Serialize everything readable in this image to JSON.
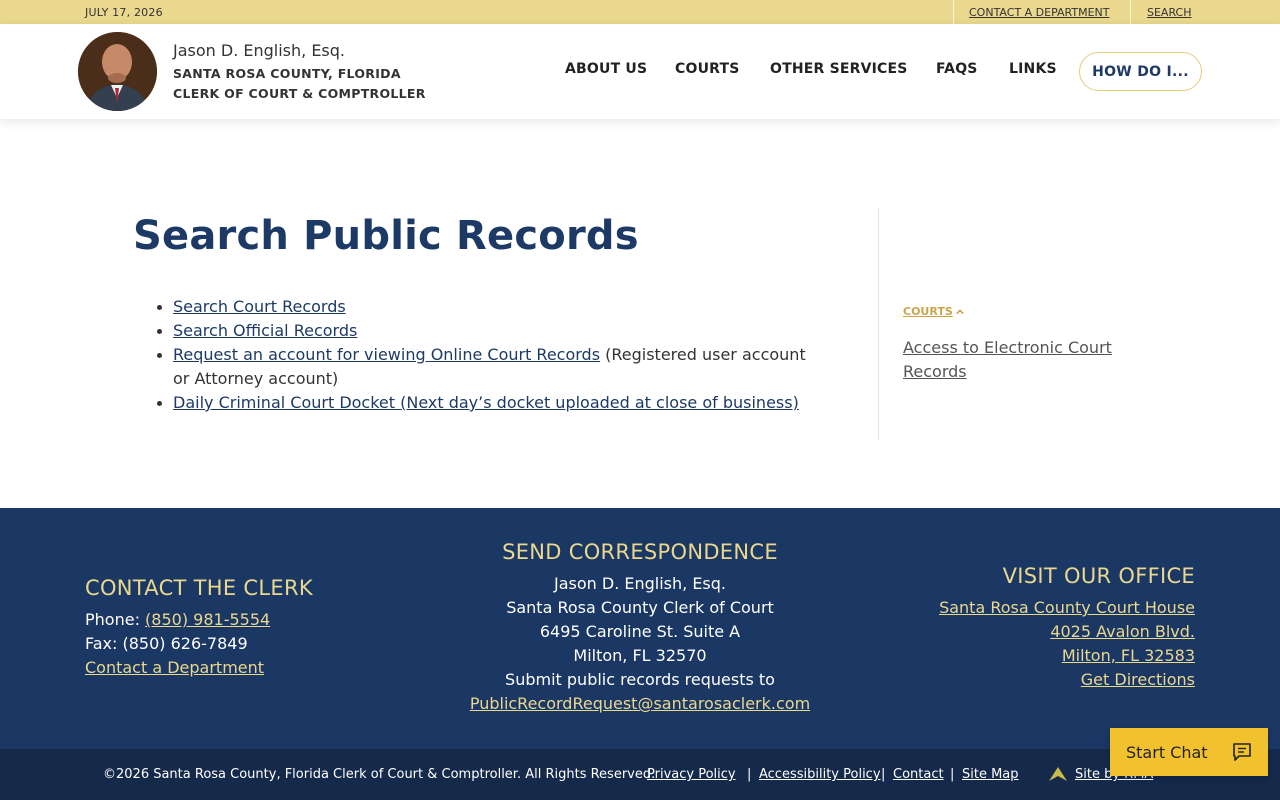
{
  "topbar": {
    "date": "JULY 17, 2026",
    "contact_link": "CONTACT A DEPARTMENT",
    "search_link": "SEARCH"
  },
  "header": {
    "name": "Jason D. English, Esq.",
    "county": "SANTA ROSA COUNTY, FLORIDA",
    "office": "CLERK OF COURT & COMPTROLLER",
    "nav": [
      "ABOUT US",
      "COURTS",
      "OTHER SERVICES",
      "FAQS",
      "LINKS"
    ],
    "howdo_label": "HOW DO I..."
  },
  "main": {
    "title": "Search Public Records",
    "links": {
      "court_records": "Search Court Records",
      "official_records": "Search Official Records",
      "request_account": "Request an account for viewing Online Court Records",
      "request_account_note": " (Registered user account or Attorney account)",
      "docket": "Daily Criminal Court Docket (Next day’s docket uploaded at close of business)"
    },
    "sidebar": {
      "category": "COURTS",
      "link": "Access to Electronic Court Records"
    }
  },
  "footer": {
    "contact": {
      "heading": "CONTACT THE CLERK",
      "phone_label": "Phone: ",
      "phone": "(850) 981-5554",
      "fax": "Fax: (850) 626-7849",
      "contact_link": "Contact a Department"
    },
    "correspondence": {
      "heading": "SEND CORRESPONDENCE",
      "line1": "Jason D. English, Esq.",
      "line2": "Santa Rosa County Clerk of Court",
      "line3": "6495 Caroline St. Suite A",
      "line4": "Milton, FL 32570",
      "line5": "Submit public records requests to",
      "email": "PublicRecordRequest@santarosaclerk.com"
    },
    "office": {
      "heading": "VISIT OUR OFFICE",
      "building": "Santa Rosa County Court House",
      "street": "4025 Avalon Blvd.",
      "city": "Milton, FL 32583",
      "directions": "Get Directions"
    },
    "bottom": {
      "copyright": "©2026 Santa Rosa County, Florida Clerk of Court & Comptroller. All Rights Reserved.",
      "privacy": "Privacy Policy",
      "accessibility": "Accessibility Policy",
      "contact": "Contact",
      "sitemap": "Site Map",
      "credit": "Site by RMA"
    }
  },
  "chat": {
    "label": "Start Chat",
    "icon": "chat-bubble-icon"
  },
  "colors": {
    "navy": "#1d3a66",
    "gold": "#e9d88d",
    "chat_yellow": "#f2c12e",
    "footer_bg": "#1b3764"
  }
}
